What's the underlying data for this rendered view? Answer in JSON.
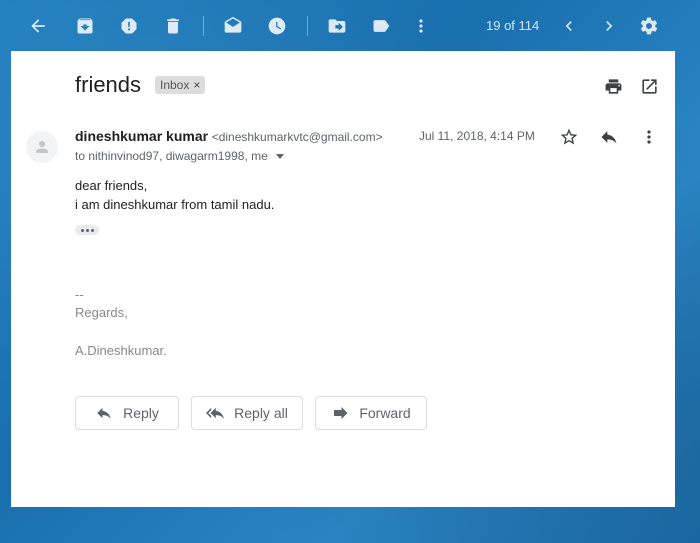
{
  "toolbar": {
    "back_icon": "arrow-back-icon",
    "archive_icon": "archive-icon",
    "spam_icon": "report-spam-icon",
    "delete_icon": "trash-icon",
    "mark_unread_icon": "mark-unread-icon",
    "snooze_icon": "clock-icon",
    "move_icon": "move-to-folder-icon",
    "label_icon": "label-icon",
    "more_icon": "more-vert-icon",
    "page_count": "19 of 114",
    "prev_icon": "chevron-left-icon",
    "next_icon": "chevron-right-icon",
    "settings_icon": "gear-icon"
  },
  "email": {
    "subject": "friends",
    "label": "Inbox",
    "label_remove": "×",
    "sender_name": "dineshkumar kumar",
    "sender_email": "<dineshkumarkvtc@gmail.com>",
    "date": "Jul 11, 2018, 4:14 PM",
    "to": "to nithinvinod97, diwagarm1998, me",
    "body_line1": "dear friends,",
    "body_line2": "i am dineshkumar from tamil nadu.",
    "sig_dash": "--",
    "sig_regards": "Regards,",
    "sig_name": "A.Dineshkumar."
  },
  "actions": {
    "reply": "Reply",
    "reply_all": "Reply all",
    "forward": "Forward"
  },
  "colors": {
    "background": "#1f7fbf",
    "card": "#ffffff",
    "text_primary": "#202124",
    "text_secondary": "#5f6368"
  }
}
